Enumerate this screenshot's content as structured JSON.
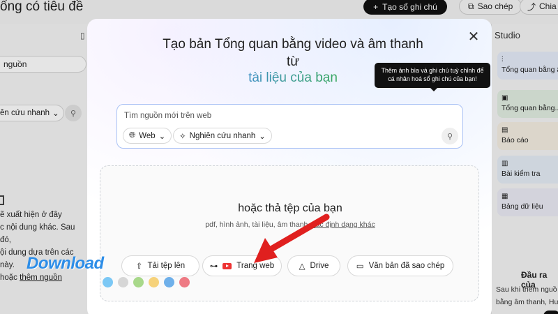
{
  "app": {
    "title": "ổng có tiêu đề",
    "new_note_label": "Tạo sổ ghi chú",
    "copy_label": "Sao chép",
    "share_label": "Chia"
  },
  "left_panel": {
    "search_text": "nguồn",
    "research_label": "ên cứu nhanh",
    "empty_lines": [
      "ẽ xuất hiện ở đây",
      "c nội dung khác. Sau đó,",
      "ội dung dựa trên các",
      "này."
    ],
    "empty_link_prefix": "hoặc",
    "empty_link": "thêm nguồn"
  },
  "right_panel": {
    "title": "Studio",
    "cards": [
      {
        "icon": "audio-overview-icon",
        "glyph": "⫶",
        "label": "Tổng quan bằng âm",
        "color": "#e6ecfa"
      },
      {
        "icon": "video-overview-icon",
        "glyph": "▣",
        "label": "Tổng quan bằng...",
        "color": "#e3efe3"
      },
      {
        "icon": "report-icon",
        "glyph": "▤",
        "label": "Báo cáo",
        "color": "#f5efe2"
      },
      {
        "icon": "quiz-icon",
        "glyph": "▥",
        "label": "Bài kiểm tra",
        "color": "#e6eef6"
      },
      {
        "icon": "data-table-icon",
        "glyph": "▦",
        "label": "Bảng dữ liệu",
        "color": "#ebebf5"
      }
    ],
    "footer_title": "Đầu ra của",
    "footer_lines": [
      "Sau khi thêm nguồ",
      "bằng âm thanh, Hư"
    ]
  },
  "modal": {
    "title": "Tạo bản Tổng quan bằng video và âm thanh từ",
    "subtitle": "tài liệu của bạn",
    "tooltip": "Thêm ảnh bìa và ghi chú tuỳ chỉnh để cá nhân hoá sổ ghi chú của bạn!",
    "search": {
      "placeholder": "Tìm nguồn mới trên web",
      "source_chip": "Web",
      "mode_chip": "Nghiên cứu nhanh"
    },
    "drop": {
      "title": "hoặc thả tệp của bạn",
      "formats_prefix": "pdf, hình ảnh, tài liệu, âm thanh,",
      "formats_link": "các định dạng khác"
    },
    "buttons": {
      "upload": "Tải tệp lên",
      "website": "Trang web",
      "drive": "Drive",
      "copied_text": "Văn bản đã sao chép"
    }
  },
  "watermark": {
    "text": "Download",
    "dot_colors": [
      "#7cc8f5",
      "#d6d6d6",
      "#a8d88a",
      "#f6d27a",
      "#6fb0ea",
      "#ee7a84"
    ]
  },
  "colors": {
    "accent_blue": "#4285f4",
    "accent_green": "#34a853",
    "arrow_red": "#e0201f"
  }
}
